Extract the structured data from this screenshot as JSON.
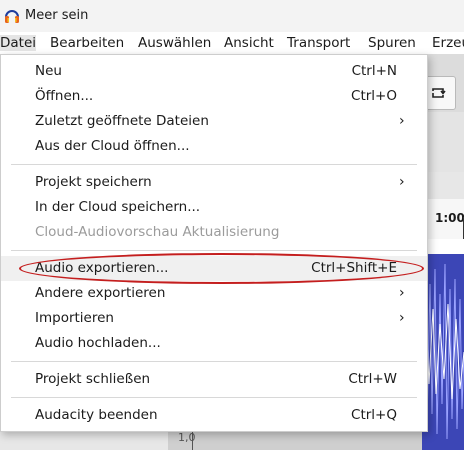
{
  "window": {
    "title": "Meer sein"
  },
  "menubar": [
    "Datei",
    "Bearbeiten",
    "Auswählen",
    "Ansicht",
    "Transport",
    "Spuren",
    "Erzeu"
  ],
  "timeline": {
    "label": "1:00"
  },
  "track_bottom_label": "1,0",
  "menu": {
    "neu": {
      "label": "Neu",
      "shortcut": "Ctrl+N"
    },
    "oeffnen": {
      "label": "Öffnen...",
      "shortcut": "Ctrl+O"
    },
    "zuletzt": {
      "label": "Zuletzt geöffnete Dateien"
    },
    "cloud_oeffnen": {
      "label": "Aus der Cloud öffnen..."
    },
    "projekt_speichern": {
      "label": "Projekt speichern"
    },
    "cloud_speichern": {
      "label": "In der Cloud speichern..."
    },
    "cloud_vorschau": {
      "label": "Cloud-Audiovorschau Aktualisierung"
    },
    "audio_exportieren": {
      "label": "Audio exportieren...",
      "shortcut": "Ctrl+Shift+E"
    },
    "andere_exportieren": {
      "label": "Andere exportieren"
    },
    "importieren": {
      "label": "Importieren"
    },
    "audio_hochladen": {
      "label": "Audio hochladen..."
    },
    "projekt_schliessen": {
      "label": "Projekt schließen",
      "shortcut": "Ctrl+W"
    },
    "beenden": {
      "label": "Audacity beenden",
      "shortcut": "Ctrl+Q"
    }
  },
  "colors": {
    "accent_highlight": "#c41e1e",
    "waveform": "#3c46b6"
  },
  "icons": {
    "app": "audacity-headphones-icon",
    "submenu": "chevron-right-icon",
    "loop": "loop-icon"
  }
}
